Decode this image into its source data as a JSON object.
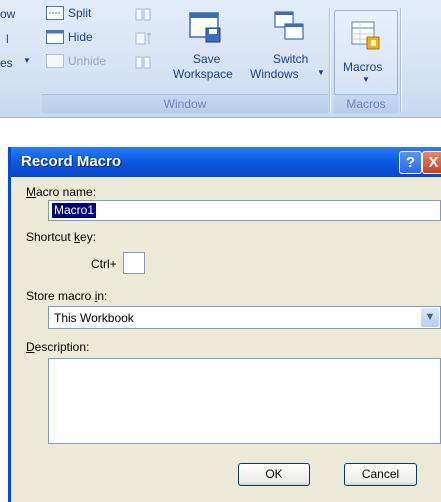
{
  "ribbon": {
    "row1_cut": "ow",
    "row2_cut": "l",
    "row3_cut": "es",
    "split_label": "Split",
    "hide_label": "Hide",
    "unhide_label": "Unhide",
    "save_workspace_line1": "Save",
    "save_workspace_line2": "Workspace",
    "switch_windows_line1": "Switch",
    "switch_windows_line2": "Windows",
    "macros_label": "Macros",
    "window_group_label": "Window",
    "macros_group_label": "Macros"
  },
  "dialog": {
    "title": "Record Macro",
    "help_button": "?",
    "close_button": "X",
    "macro_name_label_key": "M",
    "macro_name_label_rest": "acro name:",
    "macro_name_value": "Macro1",
    "shortcut_label_pre": "Shortcut ",
    "shortcut_label_key": "k",
    "shortcut_label_post": "ey:",
    "ctrl_prefix": "Ctrl+",
    "shortcut_value": "",
    "store_label_pre": "Store macro ",
    "store_label_key": "i",
    "store_label_post": "n:",
    "store_value": "This Workbook",
    "description_label_key": "D",
    "description_label_rest": "escription:",
    "description_value": "",
    "ok_label": "OK",
    "cancel_label": "Cancel"
  }
}
